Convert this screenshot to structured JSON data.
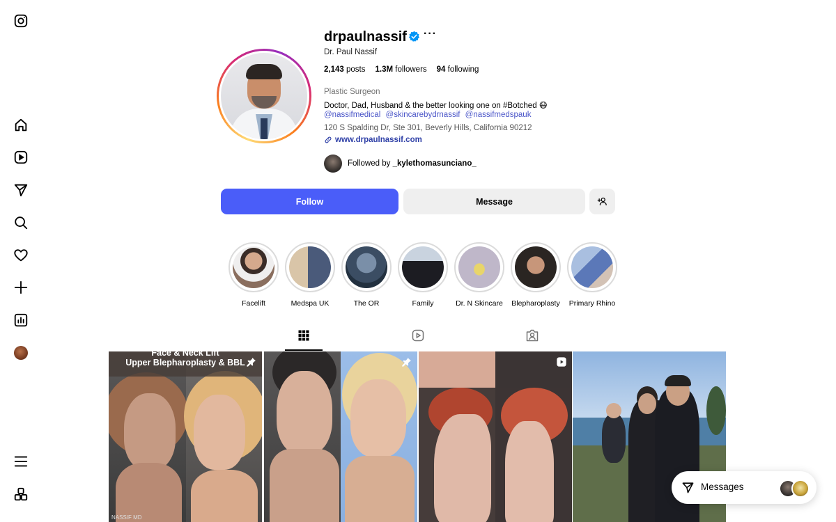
{
  "nav": {
    "items": [
      {
        "icon": "instagram-logo-icon"
      },
      {
        "icon": "home-icon"
      },
      {
        "icon": "reels-icon"
      },
      {
        "icon": "direct-send-icon"
      },
      {
        "icon": "search-icon"
      },
      {
        "icon": "heart-icon"
      },
      {
        "icon": "create-plus-icon"
      },
      {
        "icon": "dashboard-chart-icon"
      },
      {
        "icon": "profile-avatar"
      },
      {
        "icon": "menu-icon"
      },
      {
        "icon": "also-from-meta-icon"
      }
    ]
  },
  "profile": {
    "username": "drpaulnassif",
    "more": "···",
    "full_name": "Dr. Paul Nassif",
    "posts_count": "2,143",
    "posts_label": "posts",
    "followers_count": "1.3M",
    "followers_label": "followers",
    "following_count": "94",
    "following_label": "following",
    "category": "Plastic Surgeon",
    "bio": "Doctor, Dad, Husband & the better looking one on #Botched 😷",
    "mentions": [
      "@nassifmedical",
      "@skincarebydrnassif",
      "@nassifmedspauk"
    ],
    "address": "120 S Spalding Dr, Ste 301, Beverly Hills, California 90212",
    "website": "www.drpaulnassif.com",
    "followed_by_prefix": "Followed by",
    "followed_by_user": "_kylethomasunciano_"
  },
  "actions": {
    "follow_label": "Follow",
    "message_label": "Message"
  },
  "highlights": [
    {
      "label": "Facelift"
    },
    {
      "label": "Medspa UK"
    },
    {
      "label": "The OR"
    },
    {
      "label": "Family"
    },
    {
      "label": "Dr. N Skincare"
    },
    {
      "label": "Blepharoplasty"
    },
    {
      "label": "Primary Rhino"
    }
  ],
  "tabs": [
    {
      "icon": "grid-icon",
      "active": true
    },
    {
      "icon": "reels-tab-icon",
      "active": false
    },
    {
      "icon": "tagged-icon",
      "active": false
    }
  ],
  "posts": [
    {
      "banner_line1": "Face & Neck Lift",
      "banner_line2": "Upper Blepharoplasty & BBL",
      "pinned": true,
      "watermark": "NASSIF MD"
    },
    {
      "pinned": true
    },
    {
      "video": true
    },
    {}
  ],
  "messages": {
    "label": "Messages"
  },
  "colors": {
    "accent": "#4a5df9",
    "link": "#3142a8",
    "mention": "#4a55c8",
    "verified": "#0095f6"
  }
}
